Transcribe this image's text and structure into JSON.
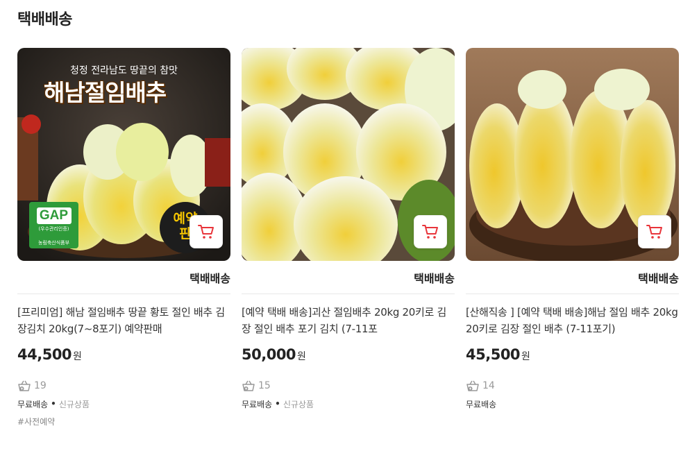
{
  "section": {
    "title": "택배배송"
  },
  "thumb1": {
    "sub": "청정 전라남도 땅끝의 참맛",
    "title": "해남절임배추",
    "gap": "GAP",
    "gap_small": "(우수관리인증)",
    "gap_org": "농림축산식품부",
    "reserve": "예약\n판"
  },
  "products": [
    {
      "ship_label": "택배배송",
      "name": "[프리미엄] 해남 절임배추 땅끝 황토 절인 배추 김장김치 20kg(7~8포기) 예약판매",
      "price": "44,500",
      "currency": "원",
      "purchase_count": "19",
      "free_shipping": "무료배송",
      "new_badge": "신규상품",
      "tag": "#사전예약"
    },
    {
      "ship_label": "택배배송",
      "name": "[예약 택배 배송]괴산 절임배추 20kg 20키로 김장 절인 배추 포기 김치 (7-11포",
      "price": "50,000",
      "currency": "원",
      "purchase_count": "15",
      "free_shipping": "무료배송",
      "new_badge": "신규상품"
    },
    {
      "ship_label": "택배배송",
      "name": "[산해직송 ] [예약 택배 배송]해남 절임 배추 20kg 20키로 김장 절인 배추 (7-11포기)",
      "price": "45,500",
      "currency": "원",
      "purchase_count": "14",
      "free_shipping": "무료배송"
    }
  ],
  "icons": {
    "cart": "cart-icon",
    "purchase": "basket-icon"
  },
  "colors": {
    "cart_red": "#e8343a",
    "text": "#222222",
    "muted": "#999999"
  }
}
